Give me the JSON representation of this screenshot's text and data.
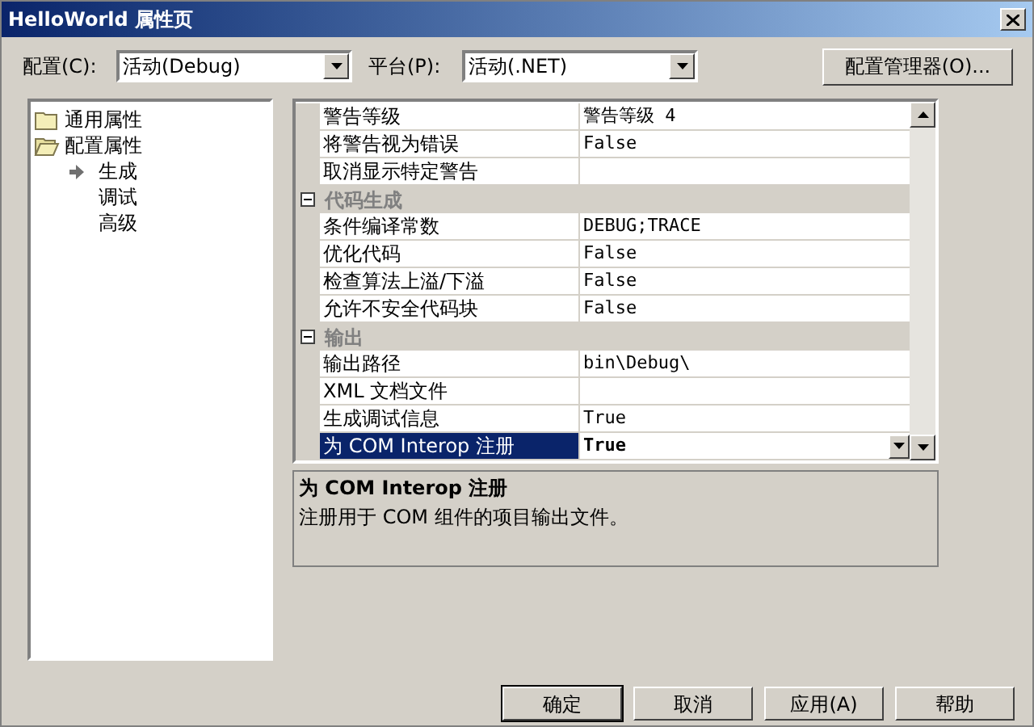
{
  "window": {
    "title": "HelloWorld 属性页"
  },
  "config": {
    "label": "配置(C):",
    "value": "活动(Debug)"
  },
  "platform": {
    "label": "平台(P):",
    "value": "活动(.NET)"
  },
  "config_manager_button": "配置管理器(O)...",
  "tree": [
    {
      "label": "通用属性",
      "expanded": false
    },
    {
      "label": "配置属性",
      "expanded": true,
      "children": [
        {
          "label": "生成",
          "selected": true
        },
        {
          "label": "调试",
          "selected": false
        },
        {
          "label": "高级",
          "selected": false
        }
      ]
    }
  ],
  "property_grid": {
    "groups": [
      {
        "rows": [
          {
            "name": "警告等级",
            "value": "警告等级 4",
            "selected": false
          },
          {
            "name": "将警告视为错误",
            "value": "False",
            "selected": false
          },
          {
            "name": "取消显示特定警告",
            "value": "",
            "selected": false
          }
        ]
      },
      {
        "title": "代码生成",
        "expanded": true,
        "rows": [
          {
            "name": "条件编译常数",
            "value": "DEBUG;TRACE",
            "selected": false
          },
          {
            "name": "优化代码",
            "value": "False",
            "selected": false
          },
          {
            "name": "检查算法上溢/下溢",
            "value": "False",
            "selected": false
          },
          {
            "name": "允许不安全代码块",
            "value": "False",
            "selected": false
          }
        ]
      },
      {
        "title": "输出",
        "expanded": true,
        "rows": [
          {
            "name": "输出路径",
            "value": "bin\\Debug\\",
            "selected": false
          },
          {
            "name": "XML 文档文件",
            "value": "",
            "selected": false
          },
          {
            "name": "生成调试信息",
            "value": "True",
            "selected": false
          },
          {
            "name": "为 COM Interop 注册",
            "value": "True",
            "selected": true
          }
        ]
      }
    ]
  },
  "description": {
    "title": "为 COM Interop 注册",
    "text": "注册用于 COM 组件的项目输出文件。"
  },
  "buttons": [
    "确定",
    "取消",
    "应用(A)",
    "帮助"
  ]
}
